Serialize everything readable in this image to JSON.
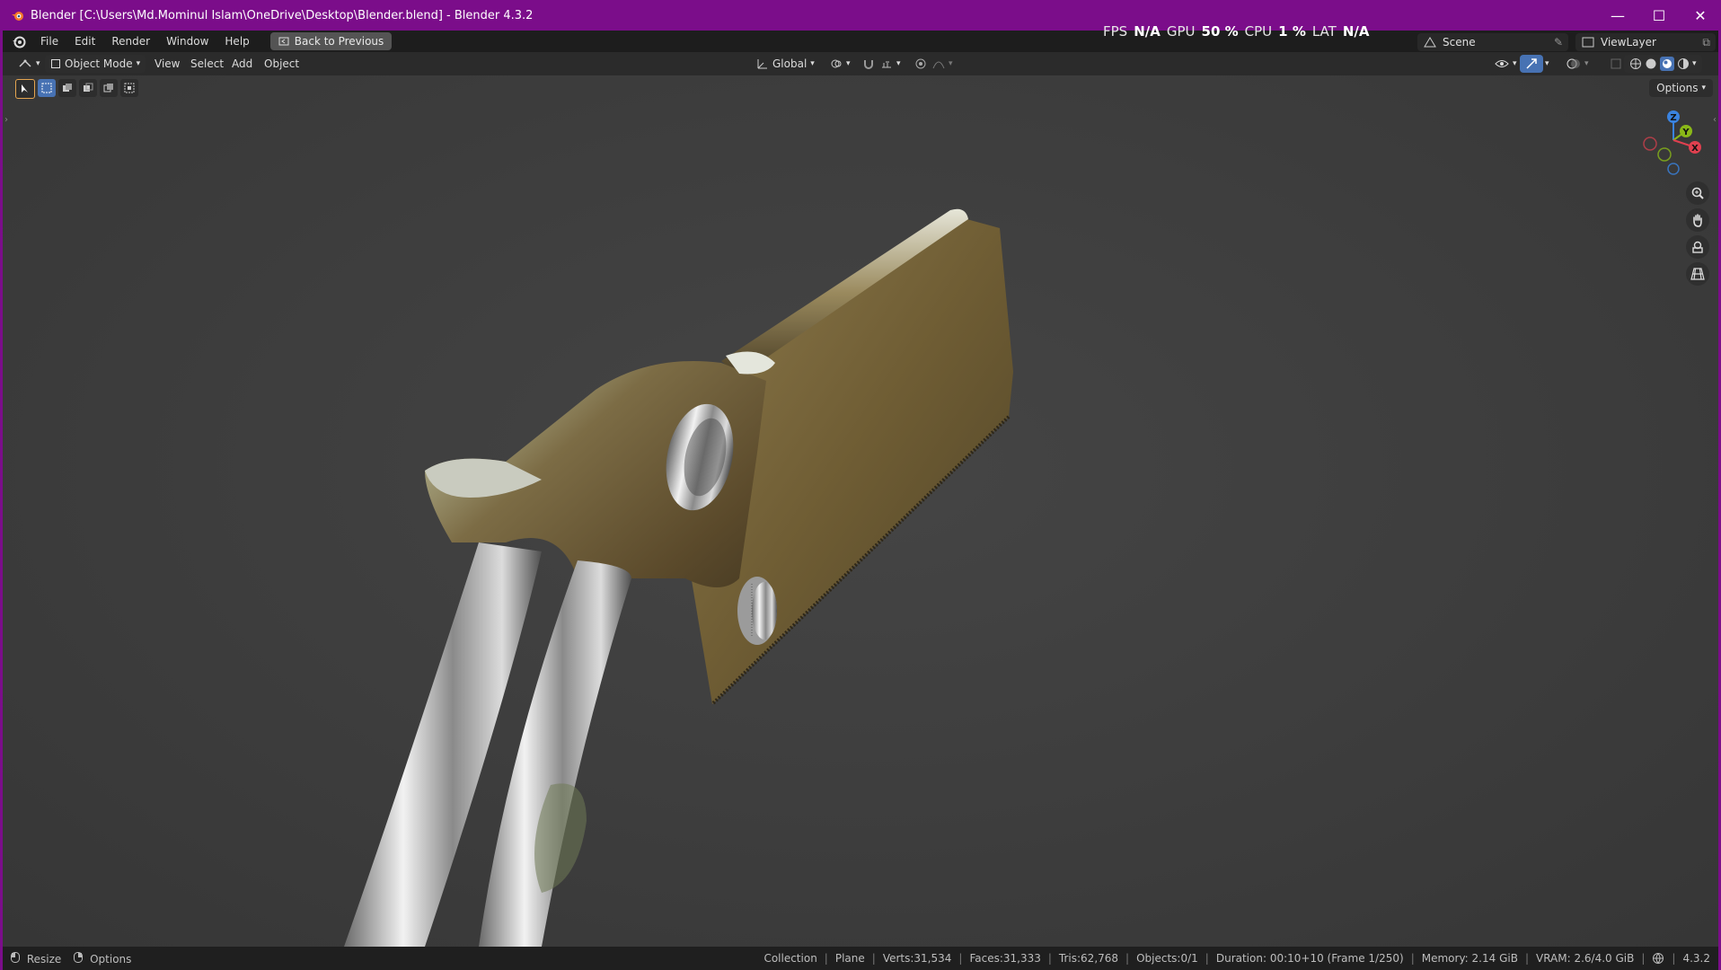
{
  "window": {
    "title": "Blender [C:\\Users\\Md.Mominul Islam\\OneDrive\\Desktop\\Blender.blend] - Blender 4.3.2",
    "controls": {
      "minimize": "—",
      "maximize": "☐",
      "close": "✕"
    }
  },
  "menubar": {
    "items": [
      "File",
      "Edit",
      "Render",
      "Window",
      "Help"
    ],
    "back_button": "Back to Previous"
  },
  "stats": {
    "fps_label": "FPS",
    "fps_value": "N/A",
    "gpu_label": "GPU",
    "gpu_value": "50 %",
    "cpu_label": "CPU",
    "cpu_value": "1 %",
    "lat_label": "LAT",
    "lat_value": "N/A"
  },
  "scene": {
    "name": "Scene"
  },
  "view_layer": {
    "name": "ViewLayer"
  },
  "header": {
    "mode": "Object Mode",
    "menus": [
      "View",
      "Select",
      "Add",
      "Object"
    ],
    "orientation": "Global"
  },
  "viewport": {
    "options_label": "Options",
    "gizmo": {
      "z": "Z",
      "y": "Y",
      "x": "X"
    }
  },
  "statusbar": {
    "left": [
      {
        "icon": "mouse-left-icon",
        "label": "Resize"
      },
      {
        "icon": "mouse-right-icon",
        "label": "Options"
      }
    ],
    "collection": "Collection",
    "object": "Plane",
    "verts": "Verts:31,534",
    "faces": "Faces:31,333",
    "tris": "Tris:62,768",
    "objects": "Objects:0/1",
    "duration": "Duration: 00:10+10 (Frame 1/250)",
    "memory": "Memory: 2.14 GiB",
    "vram": "VRAM: 2.6/4.0 GiB",
    "version": "4.3.2"
  },
  "colors": {
    "title_bar": "#7b0d8a",
    "viewport_bg": "#3d3d3d",
    "accent": "#4772b3",
    "gizmo_x": "#e0404f",
    "gizmo_y": "#8ab818",
    "gizmo_z": "#3a83e0"
  }
}
